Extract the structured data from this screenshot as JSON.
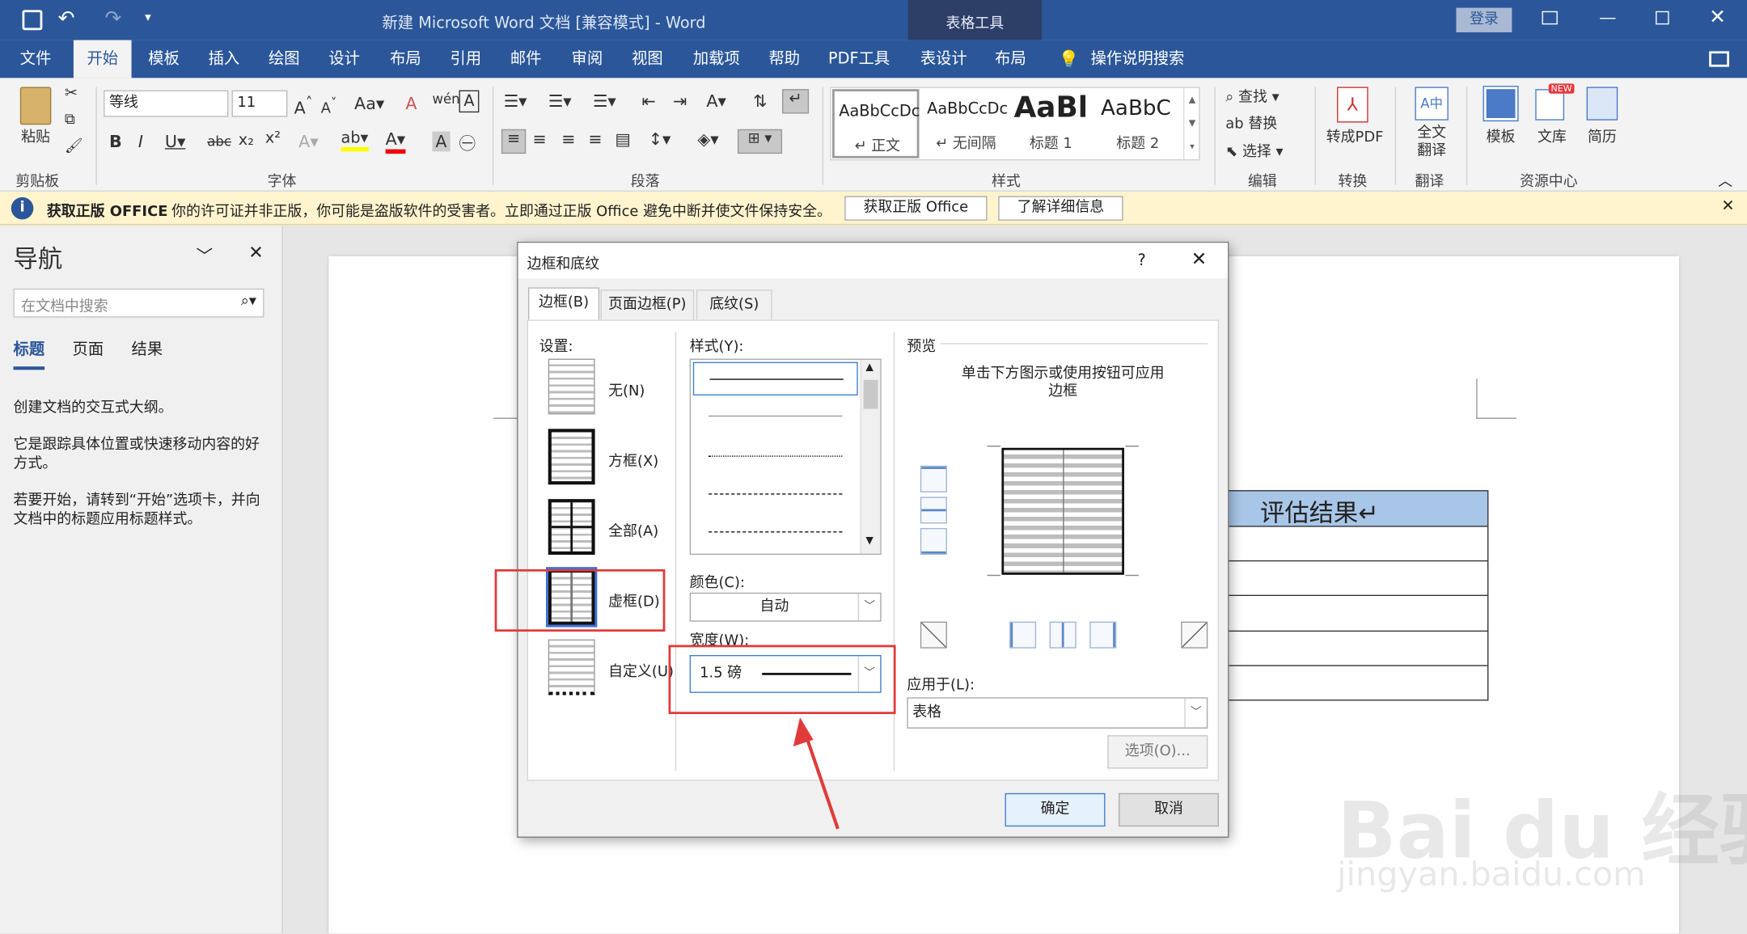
{
  "window": {
    "title": "新建 Microsoft Word 文档 [兼容模式] - Word",
    "context_tools": "表格工具",
    "login": "登录"
  },
  "tabs": [
    "文件",
    "开始",
    "模板",
    "插入",
    "绘图",
    "设计",
    "布局",
    "引用",
    "邮件",
    "审阅",
    "视图",
    "加载项",
    "帮助",
    "PDF工具",
    "表设计",
    "布局"
  ],
  "tellme": "操作说明搜索",
  "ribbon": {
    "font_name": "等线",
    "font_size": "11",
    "styles": [
      {
        "preview": "AaBbCcDc",
        "name": "↵ 正文"
      },
      {
        "preview": "AaBbCcDc",
        "name": "↵ 无间隔"
      },
      {
        "preview": "AaBl",
        "name": "标题 1"
      },
      {
        "preview": "AaBbC",
        "name": "标题 2"
      }
    ],
    "edit": {
      "find": "查找",
      "replace": "替换",
      "select": "选择"
    },
    "buttons": {
      "paste": "粘贴",
      "to_pdf": "转成PDF",
      "full_translate": "全文\n翻译",
      "template": "模板",
      "wenku": "文库",
      "resume": "简历",
      "new_badge": "NEW"
    },
    "groups": {
      "clipboard": "剪贴板",
      "font": "字体",
      "paragraph": "段落",
      "styles": "样式",
      "editing": "编辑",
      "convert": "转换",
      "translate": "翻译",
      "resources": "资源中心"
    }
  },
  "message": {
    "title": "获取正版 OFFICE",
    "text": "你的许可证并非正版，你可能是盗版软件的受害者。立即通过正版 Office 避免中断并使文件保持安全。",
    "btn1": "获取正版 Office",
    "btn2": "了解详细信息"
  },
  "nav": {
    "title": "导航",
    "search_placeholder": "在文档中搜索",
    "tabs": [
      "标题",
      "页面",
      "结果"
    ],
    "p1": "创建文档的交互式大纲。",
    "p2": "它是跟踪具体位置或快速移动内容的好方式。",
    "p3": "若要开始，请转到“开始”选项卡，并向文档中的标题应用标题样式。"
  },
  "doc": {
    "table_header": "评估结果↵"
  },
  "dialog": {
    "title": "边框和底纹",
    "help": "?",
    "tabs": [
      "边框(B)",
      "页面边框(P)",
      "底纹(S)"
    ],
    "settings_label": "设置:",
    "settings": [
      "无(N)",
      "方框(X)",
      "全部(A)",
      "虚框(D)",
      "自定义(U)"
    ],
    "style_label": "样式(Y):",
    "color_label": "颜色(C):",
    "color_value": "自动",
    "width_label": "宽度(W):",
    "width_value": "1.5 磅",
    "preview_label": "预览",
    "preview_hint": "单击下方图示或使用按钮可应用\n边框",
    "apply_label": "应用于(L):",
    "apply_value": "表格",
    "options": "选项(O)...",
    "ok": "确定",
    "cancel": "取消"
  },
  "watermark": {
    "logo": "Bai du 经验",
    "url": "jingyan.baidu.com"
  }
}
